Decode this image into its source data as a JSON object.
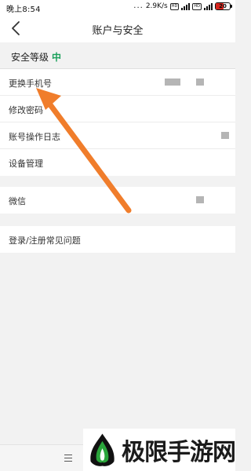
{
  "status_bar": {
    "time": "晚上8:54",
    "dots": "...",
    "speed": "2.9K/s",
    "hd1": "HD",
    "hd2": "HD",
    "battery": "20"
  },
  "nav": {
    "back_icon": "chevron-left-icon",
    "title": "账户与安全"
  },
  "security": {
    "label": "安全等级",
    "level": "中",
    "level_color": "#1aa05a"
  },
  "groups": [
    {
      "items": [
        {
          "label": "更换手机号",
          "has_redacted_value": true
        },
        {
          "label": "修改密码",
          "has_redacted_value": false
        },
        {
          "label": "账号操作日志",
          "has_redacted_value": true
        },
        {
          "label": "设备管理",
          "has_redacted_value": false
        }
      ]
    },
    {
      "items": [
        {
          "label": "微信",
          "has_redacted_value": true
        }
      ]
    },
    {
      "items": [
        {
          "label": "登录/注册常见问题",
          "has_redacted_value": false
        }
      ]
    }
  ],
  "bottom_bar": {
    "menu_icon": "menu-icon"
  },
  "watermark": {
    "text": "极限手游网",
    "logo_icon": "flame-leaf-logo"
  },
  "annotation": {
    "arrow_color": "#f07d2b",
    "points_to": "修改密码"
  }
}
